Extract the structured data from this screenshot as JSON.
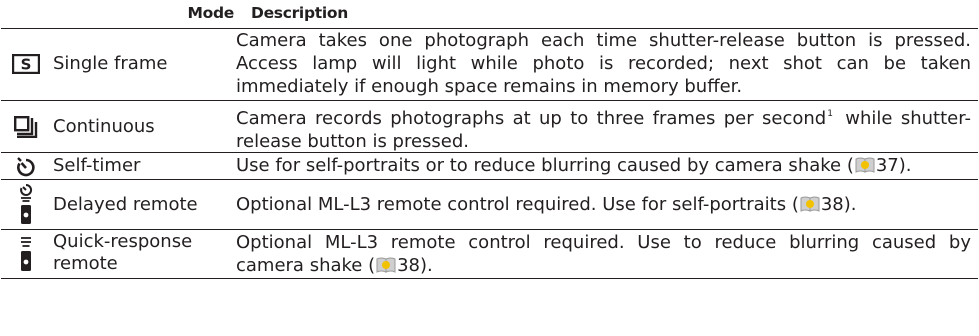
{
  "header": {
    "mode": "Mode",
    "description": "Description"
  },
  "rows": [
    {
      "icon": "single-frame-icon",
      "icon_glyph": "S",
      "mode": "Single frame",
      "description": "Camera takes one photograph each time shutter-release button is pressed. Access lamp will light while photo is recorded; next shot can be taken immediately if enough space remains in memory buffer."
    },
    {
      "icon": "continuous-icon",
      "mode": "Continuous",
      "description_pre": "Camera records photographs at up to three frames per second",
      "footnote": "1",
      "description_post": " while shutter-release button is pressed."
    },
    {
      "icon": "self-timer-icon",
      "mode": "Self-timer",
      "description_pre": "Use for self-portraits or to reduce blurring caused by camera shake (",
      "page_ref": "37",
      "description_post": ")."
    },
    {
      "icon": "delayed-remote-icon",
      "mode": "Delayed remote",
      "description_pre": "Optional ML-L3 remote control required.  Use for self-portraits (",
      "page_ref": "38",
      "description_post": ")."
    },
    {
      "icon": "quick-response-remote-icon",
      "mode_line1": "Quick-response",
      "mode_line2": "remote",
      "description_pre": "Optional ML-L3 remote control required.  Use to reduce blurring caused by camera shake (",
      "page_ref": "38",
      "description_post": ")."
    }
  ]
}
